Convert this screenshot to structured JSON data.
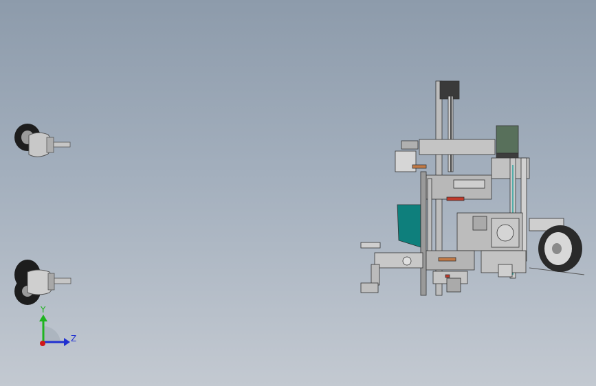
{
  "viewport": {
    "background_top": "#8d9bab",
    "background_bottom": "#c3c9d1"
  },
  "triad": {
    "y_label": "Y",
    "z_label": "Z",
    "y_color": "#1fb41f",
    "z_color": "#2030d0",
    "x_color": "#d01818"
  },
  "model": {
    "teal_color": "#0e7f7c",
    "rubber_color": "#2a2a2a",
    "metal_color": "#b9b9b9"
  }
}
